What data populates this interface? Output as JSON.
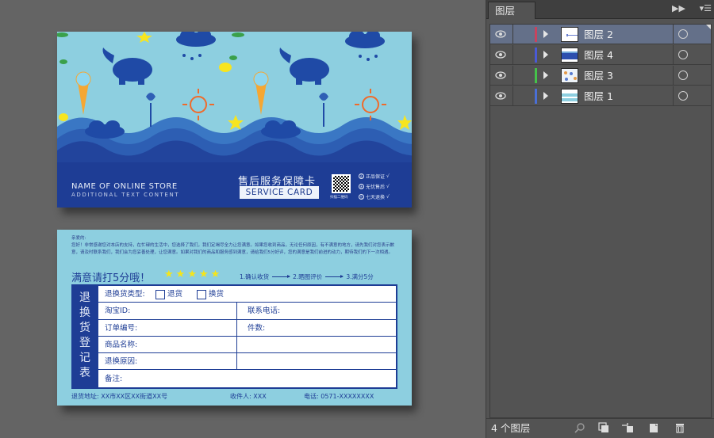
{
  "front_card": {
    "store_name": "NAME OF ONLINE STORE",
    "store_subtext": "ADDITIONAL TEXT CONTENT",
    "service_title": "售后服务保障卡",
    "service_card": "SERVICE CARD",
    "qr_label": "扫描二维码",
    "guarantees": [
      "正品保证",
      "无忧售后",
      "七天退换"
    ],
    "guarantee_icons": [
      "正",
      "无",
      "七"
    ],
    "check_mark": "√"
  },
  "back_card": {
    "greeting": "亲爱的:",
    "body_text": "您好！非常感谢您对本店的支持，在忙碌的生活中，您选择了我们，我们定竭尽全力让您满意。如果您收到商品，无论任何原因，有不满意的地方，请先我们对您表示歉意，请及时联系我们，我们会为您妥善处理，让您满意。如果对我们的商品和服务感到满意，请给我们5分好评，您的满意是我们前进的动力，期待我们的下一次相遇。",
    "satisfied_text": "满意请打5分哦！",
    "star_glyph": "★",
    "stars_count": 5,
    "steps": [
      "1.确认收货",
      "2.晒图评价",
      "3.满分5分"
    ],
    "form_side_title": "退换货登记表",
    "form": {
      "type_label": "退换货类型:",
      "return_option": "退货",
      "exchange_option": "换货",
      "taobao_id": "淘宝ID:",
      "contact_phone": "联系电话:",
      "order_number": "订单编号:",
      "quantity": "件数:",
      "product_name": "商品名称:",
      "return_reason": "退换原因:",
      "note": "备注:"
    },
    "footer": {
      "address": "退货地址: XX市XX区XX街道XX号",
      "recipient": "收件人: XXX",
      "phone": "电话: 0571-XXXXXXXX"
    }
  },
  "layers_panel": {
    "tab_title": "图层",
    "collapse_glyph": "▶▶",
    "menu_glyph": "▾☰",
    "layers": [
      {
        "name": "图层 2",
        "color": "#c8435e",
        "selected": true
      },
      {
        "name": "图层 4",
        "color": "#4a5ad6",
        "selected": false
      },
      {
        "name": "图层 3",
        "color": "#45c24a",
        "selected": false
      },
      {
        "name": "图层 1",
        "color": "#4a6fd6",
        "selected": false
      }
    ],
    "layer_count_label": "4 个图层",
    "bottom_icons": [
      "search-icon",
      "clipping-mask-icon",
      "new-sublayer-icon",
      "new-layer-icon",
      "trash-icon"
    ]
  },
  "colors": {
    "canvas_bg": "#646464",
    "card_light_blue": "#8dcfe0",
    "card_dark_blue": "#1e3d95",
    "panel_bg": "#535353",
    "selected_layer": "#647089"
  }
}
